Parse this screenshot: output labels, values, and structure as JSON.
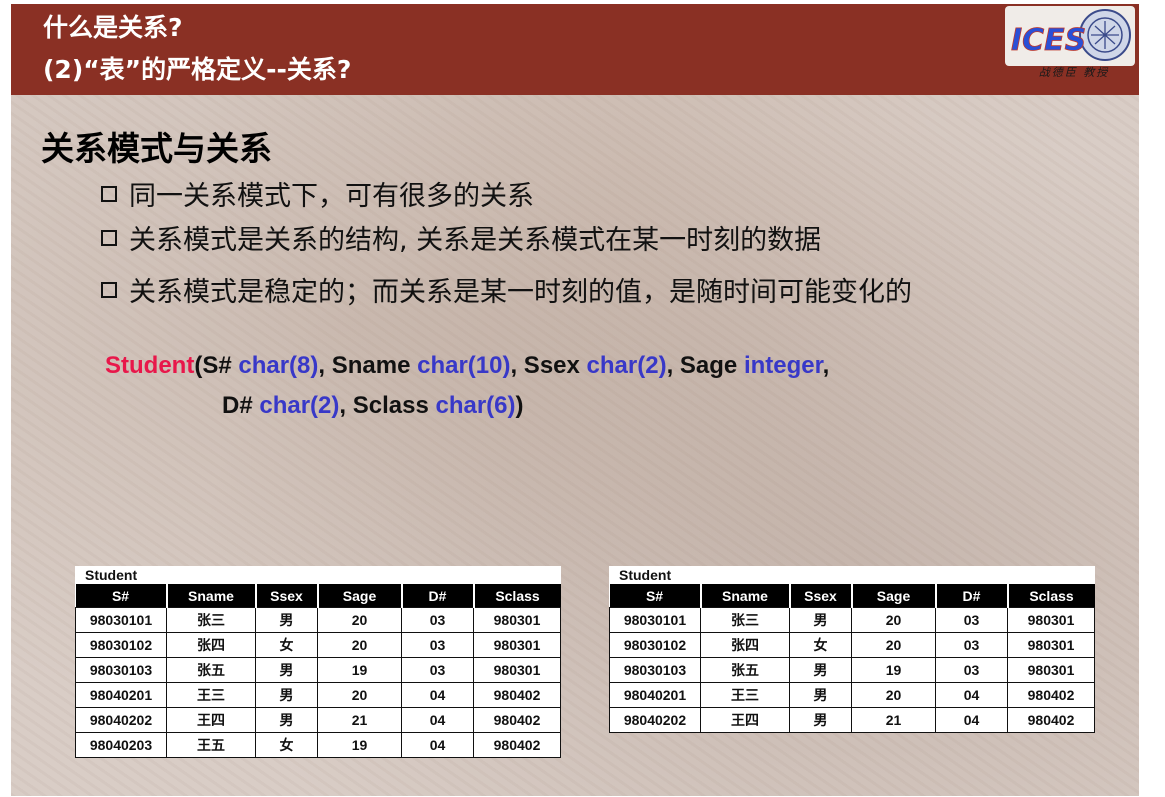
{
  "header": {
    "line1": "什么是关系?",
    "line2": "(2)“表”的严格定义--关系?",
    "logo_text": "ICES",
    "logo_caption": "战德臣 教授",
    "colors": {
      "bar": "#8a3024",
      "text": "#ffffff"
    }
  },
  "section_title": "关系模式与关系",
  "bullets": [
    "同一关系模式下，可有很多的关系",
    "关系模式是关系的结构, 关系是关系模式在某一时刻的数据",
    "关系模式是稳定的；而关系是某一时刻的值，是随时间可能变化的"
  ],
  "schema": {
    "relation": "Student",
    "line1": [
      {
        "t": "(S# ",
        "c": "plain"
      },
      {
        "t": "char(8)",
        "c": "kw"
      },
      {
        "t": ", Sname ",
        "c": "plain"
      },
      {
        "t": "char(10)",
        "c": "kw"
      },
      {
        "t": ", Ssex ",
        "c": "plain"
      },
      {
        "t": "char(2)",
        "c": "kw"
      },
      {
        "t": ", Sage ",
        "c": "plain"
      },
      {
        "t": "integer",
        "c": "kw"
      },
      {
        "t": ",",
        "c": "plain"
      }
    ],
    "line2": [
      {
        "t": "D# ",
        "c": "plain"
      },
      {
        "t": "char(2)",
        "c": "kw"
      },
      {
        "t": ",  Sclass ",
        "c": "plain"
      },
      {
        "t": "char(6)",
        "c": "kw"
      },
      {
        "t": ")",
        "c": "plain"
      }
    ],
    "colors": {
      "relation": "#e8174a",
      "keyword": "#3838c8"
    }
  },
  "tables": [
    {
      "caption": "Student",
      "columns": [
        "S#",
        "Sname",
        "Ssex",
        "Sage",
        "D#",
        "Sclass"
      ],
      "rows": [
        [
          "98030101",
          "张三",
          "男",
          "20",
          "03",
          "980301"
        ],
        [
          "98030102",
          "张四",
          "女",
          "20",
          "03",
          "980301"
        ],
        [
          "98030103",
          "张五",
          "男",
          "19",
          "03",
          "980301"
        ],
        [
          "98040201",
          "王三",
          "男",
          "20",
          "04",
          "980402"
        ],
        [
          "98040202",
          "王四",
          "男",
          "21",
          "04",
          "980402"
        ],
        [
          "98040203",
          "王五",
          "女",
          "19",
          "04",
          "980402"
        ]
      ]
    },
    {
      "caption": "Student",
      "columns": [
        "S#",
        "Sname",
        "Ssex",
        "Sage",
        "D#",
        "Sclass"
      ],
      "rows": [
        [
          "98030101",
          "张三",
          "男",
          "20",
          "03",
          "980301"
        ],
        [
          "98030102",
          "张四",
          "女",
          "20",
          "03",
          "980301"
        ],
        [
          "98030103",
          "张五",
          "男",
          "19",
          "03",
          "980301"
        ],
        [
          "98040201",
          "王三",
          "男",
          "20",
          "04",
          "980402"
        ],
        [
          "98040202",
          "王四",
          "男",
          "21",
          "04",
          "980402"
        ]
      ]
    }
  ]
}
